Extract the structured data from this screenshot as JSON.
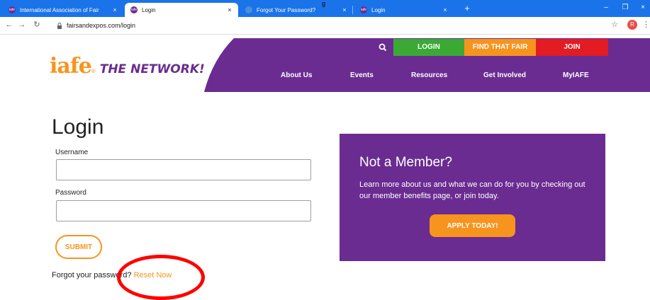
{
  "browser": {
    "tabs": [
      {
        "title": "International Association of Fair",
        "active": false
      },
      {
        "title": "Login",
        "active": true
      },
      {
        "title": "Forgot Your Password?",
        "active": false
      },
      {
        "title": "Login",
        "active": false
      }
    ],
    "close_glyph": "×",
    "new_tab_glyph": "+",
    "url": "fairsandexpos.com/login",
    "profile_initial": "R",
    "window_controls": [
      "–",
      "❐",
      "×"
    ],
    "favicon_text": "iafe",
    "top_glyph": "g"
  },
  "site": {
    "logo": {
      "iafe": "iafe",
      "reg": "®",
      "network": "THE NETWORK!"
    },
    "top_buttons": {
      "login": "LOGIN",
      "find": "FIND THAT FAIR",
      "join": "JOIN"
    },
    "nav": [
      "About Us",
      "Events",
      "Resources",
      "Get Involved",
      "MyIAFE"
    ],
    "colors": {
      "purple": "#6a2c91",
      "orange": "#f7941d",
      "green": "#3aaa35",
      "red": "#e31b23"
    }
  },
  "login": {
    "heading": "Login",
    "username_label": "Username",
    "username_value": "",
    "password_label": "Password",
    "password_value": "",
    "submit_label": "SUBMIT",
    "forgot_text": "Forgot your password?",
    "reset_link": "Reset Now"
  },
  "member": {
    "title": "Not a Member?",
    "text": "Learn more about us and what we can do for you by checking out our member benefits page, or join today.",
    "apply_label": "APPLY TODAY!"
  }
}
